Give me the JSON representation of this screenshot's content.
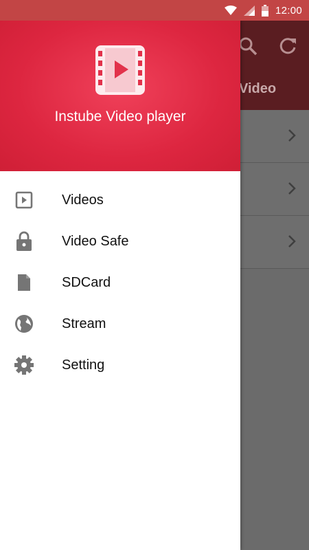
{
  "status_bar": {
    "time": "12:00"
  },
  "app_background": {
    "tab_label": "Video"
  },
  "drawer": {
    "header": {
      "title": "Instube Video player"
    },
    "menu": [
      {
        "label": "Videos",
        "icon": "play-box-icon"
      },
      {
        "label": "Video Safe",
        "icon": "lock-icon"
      },
      {
        "label": "SDCard",
        "icon": "file-icon"
      },
      {
        "label": "Stream",
        "icon": "globe-icon"
      },
      {
        "label": "Setting",
        "icon": "gear-icon"
      }
    ]
  },
  "colors": {
    "status_bar": "#c24545",
    "drawer_header": "#dd2640",
    "scrim": "#6b6b6b",
    "icon_gray": "#757575"
  }
}
